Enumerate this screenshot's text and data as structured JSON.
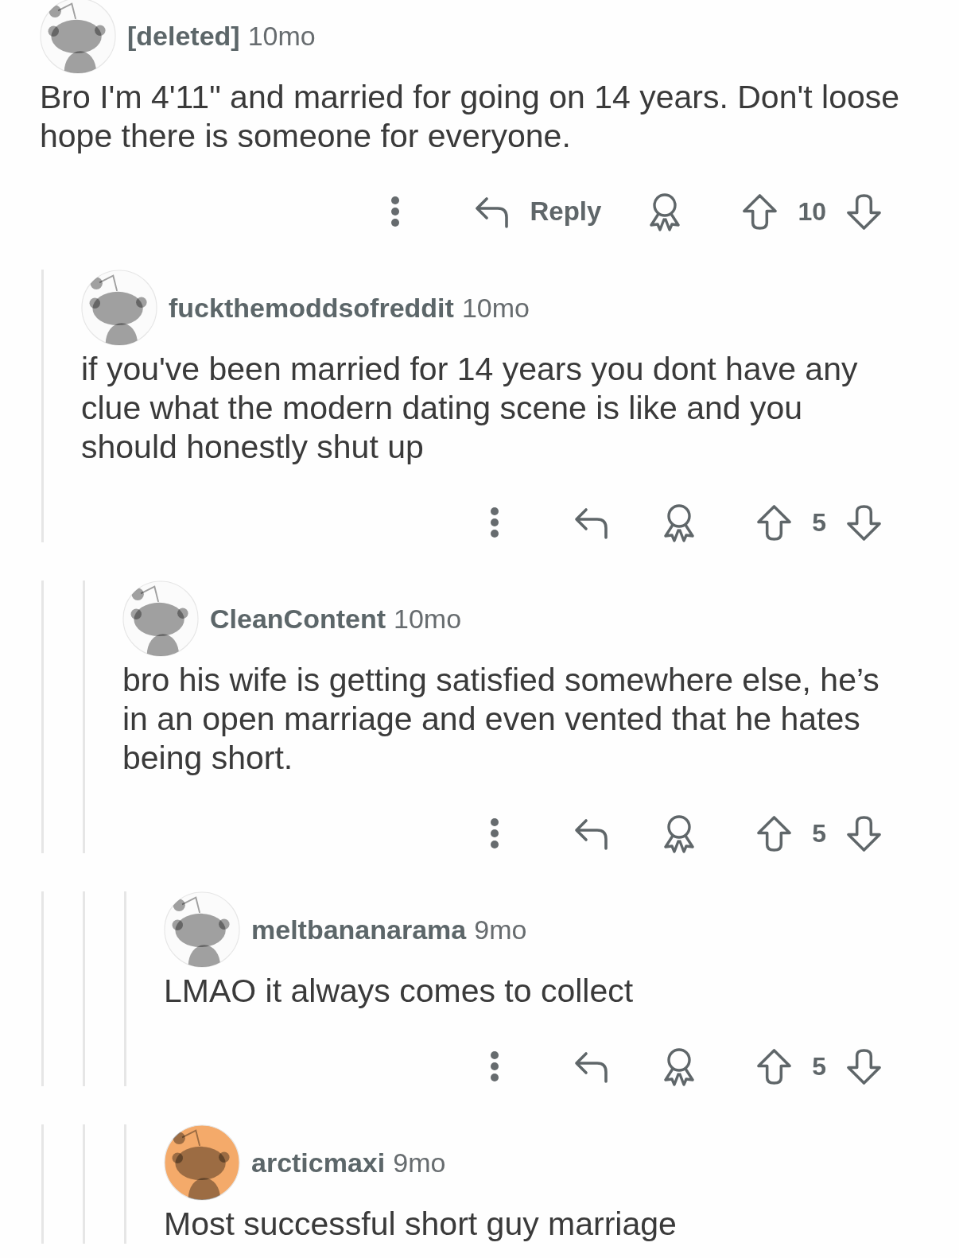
{
  "comments": [
    {
      "author": "[deleted]",
      "age": "10mo",
      "avatar": {
        "color": "#fbfbfb"
      },
      "body": "Bro I'm 4'11\" and married for going on 14 years. Don't loose hope there is someone for everyone.",
      "actions": {
        "reply_label": "Reply",
        "score": "10"
      },
      "children": [
        {
          "author": "fuckthemoddsofreddit",
          "age": "10mo",
          "avatar": {
            "color": "#fbfbfb"
          },
          "body": "if you've been married for 14 years you dont have any clue what the modern dating scene is like and you should honestly shut up",
          "actions": {
            "score": "5"
          },
          "children": [
            {
              "author": "CleanContent",
              "age": "10mo",
              "avatar": {
                "color": "#fbfbfb"
              },
              "body": "bro his wife is getting satisfied somewhere else, he’s in an open marriage and even vented that he hates being short.",
              "actions": {
                "score": "5"
              },
              "children": [
                {
                  "author": "meltbananarama",
                  "age": "9mo",
                  "avatar": {
                    "color": "#fbfbfb"
                  },
                  "body": "LMAO it always comes to collect",
                  "actions": {
                    "score": "5"
                  }
                },
                {
                  "author": "arcticmaxi",
                  "age": "9mo",
                  "avatar": {
                    "color": "#f4aa6a"
                  },
                  "body": "Most successful short guy marriage"
                }
              ]
            }
          ]
        }
      ]
    }
  ]
}
